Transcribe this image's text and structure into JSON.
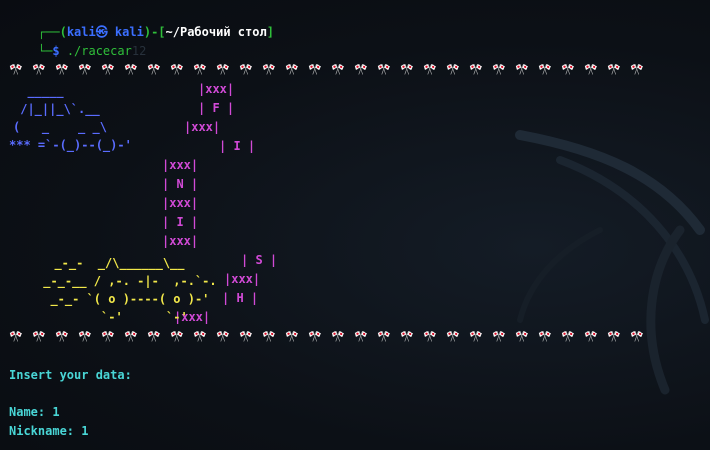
{
  "prompt": {
    "frame_top": "┌──(",
    "user": "kali㉿ kali",
    "frame_mid": ")-[",
    "path": "~/Рабочий стол",
    "frame_end": "]",
    "frame_bottom": "└─",
    "dollar": "$ ",
    "command": "./racecar"
  },
  "ghost_text": "12",
  "flag_row_count": 28,
  "flag_glyph": "🎌",
  "car_blue": [
    "  _____",
    " /|_||_\\`.__",
    "(   _    _ _\\",
    "*** =`-(_)--(_)-'"
  ],
  "car_yellow": [
    "  _-_-  _/\\______\\__",
    " _-_-__ / ,-. -|-  ,-.`-.",
    "  _-_- `( o )----( o )-'",
    "         `-'      `-'"
  ],
  "track": [
    {
      "text": "|xxx|",
      "row": "r1"
    },
    {
      "text": "| F |",
      "row": "r2"
    },
    {
      "text": "|xxx|",
      "row": "r3"
    },
    {
      "text": "| I |",
      "row": "r4"
    },
    {
      "text": "|xxx|",
      "row": "r5"
    },
    {
      "text": "| N |",
      "row": "r6"
    },
    {
      "text": "|xxx|",
      "row": "r7"
    },
    {
      "text": "| I |",
      "row": "r8"
    },
    {
      "text": "|xxx|",
      "row": "r9"
    },
    {
      "text": "| S |",
      "row": "r10"
    },
    {
      "text": "|xxx|",
      "row": "r11"
    },
    {
      "text": "| H |",
      "row": "r12"
    },
    {
      "text": "|xxx|",
      "row": "r13"
    }
  ],
  "output": {
    "insert_label": "Insert your data:",
    "name_line": "Name: 1",
    "nickname_line": "Nickname: 1"
  },
  "colors": {
    "prompt_green": "#2fbf3a",
    "prompt_blue": "#3b6fff",
    "car_blue": "#5a6cff",
    "car_yellow": "#f2e84a",
    "track_magenta": "#d14ad6",
    "output_cyan": "#49d6d6"
  }
}
